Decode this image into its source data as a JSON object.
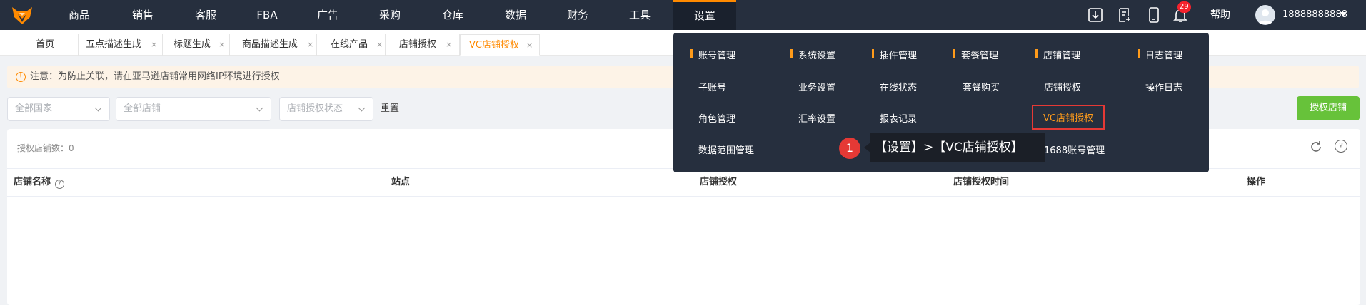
{
  "nav": {
    "items": [
      "商品",
      "销售",
      "客服",
      "FBA",
      "广告",
      "采购",
      "仓库",
      "数据",
      "财务",
      "工具",
      "设置"
    ],
    "active": "设置",
    "notification_count": "29",
    "help_label": "帮助",
    "username": "18888888888"
  },
  "tabs": [
    {
      "label": "首页"
    },
    {
      "label": "五点描述生成",
      "close": "×"
    },
    {
      "label": "标题生成",
      "close": "×"
    },
    {
      "label": "商品描述生成",
      "close": "×"
    },
    {
      "label": "在线产品",
      "close": "×"
    },
    {
      "label": "店铺授权",
      "close": "×"
    },
    {
      "label": "VC店铺授权",
      "close": "×",
      "active": true
    }
  ],
  "notice": {
    "icon": "!",
    "text": "注意：为防止关联，请在亚马逊店铺常用网络IP环境进行授权"
  },
  "filters": {
    "country": "全部国家",
    "store": "全部店铺",
    "auth_status": "店铺授权状态",
    "reset_label": "重置",
    "auth_button": "授权店铺"
  },
  "table": {
    "count_label": "授权店铺数：0",
    "help_glyph": "?",
    "columns": [
      "店铺名称",
      "站点",
      "店铺授权",
      "店铺授权时间",
      "操作"
    ]
  },
  "settings_menu": {
    "columns": [
      {
        "title": "账号管理",
        "items": [
          "子账号",
          "角色管理",
          "数据范围管理"
        ]
      },
      {
        "title": "系统设置",
        "items": [
          "业务设置",
          "汇率设置"
        ]
      },
      {
        "title": "插件管理",
        "items": [
          "在线状态",
          "报表记录"
        ]
      },
      {
        "title": "套餐管理",
        "items": [
          "套餐购买"
        ]
      },
      {
        "title": "店铺管理",
        "items": [
          "店铺授权",
          "VC店铺授权",
          "1688账号管理"
        ]
      },
      {
        "title": "日志管理",
        "items": [
          "操作日志"
        ]
      }
    ],
    "highlighted": "VC店铺授权"
  },
  "annotation": {
    "step": "1",
    "text": "【设置】>【VC店铺授权】"
  },
  "colors": {
    "nav_bg": "#262f3e",
    "accent": "#ff8a00",
    "primary_green": "#67c23a",
    "highlight_red": "#e53935"
  }
}
